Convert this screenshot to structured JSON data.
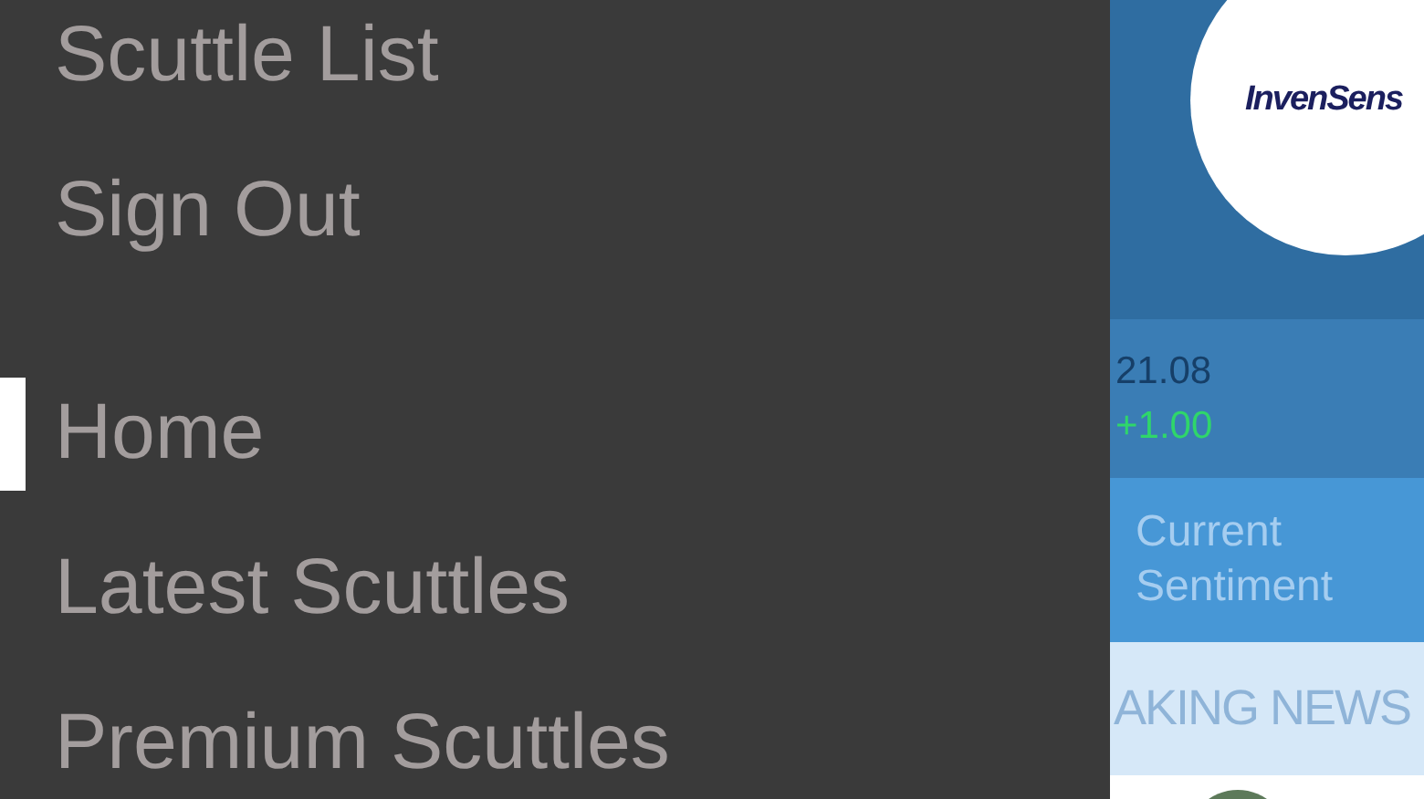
{
  "menu": {
    "account_items": [
      {
        "label": "Scuttle List"
      },
      {
        "label": "Sign Out"
      }
    ],
    "nav_items": [
      {
        "label": "Home",
        "selected": true
      },
      {
        "label": "Latest Scuttles",
        "selected": false
      },
      {
        "label": "Premium Scuttles",
        "selected": false
      }
    ]
  },
  "stock": {
    "logo_text": "InvenSens",
    "price": "21.08",
    "change": "+1.00",
    "sentiment_label": "Current Sentiment",
    "news_banner": "AKING NEWS"
  }
}
